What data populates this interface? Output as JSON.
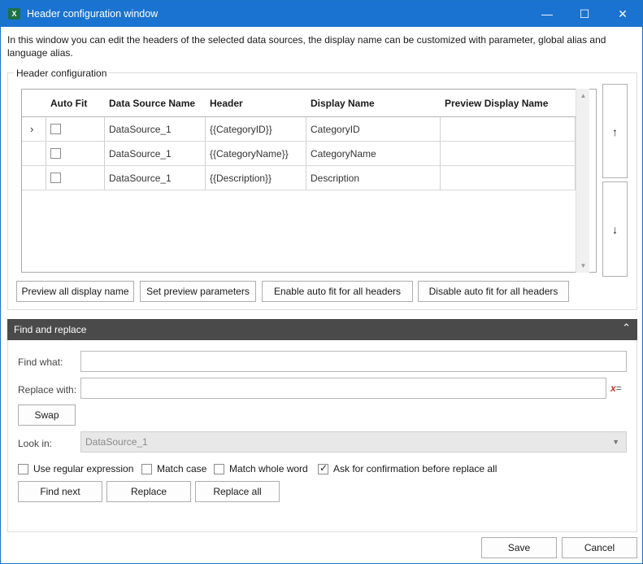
{
  "window": {
    "title": "Header configuration window",
    "app_icon": "excel-icon",
    "controls": [
      "minimize-icon",
      "maximize-icon",
      "close-icon"
    ]
  },
  "intro_text": "In this window you can edit the headers of the selected data sources, the display name can be customized with parameter, global alias and language alias.",
  "header_config": {
    "legend": "Header configuration",
    "columns": [
      "Auto Fit",
      "Data Source Name",
      "Header",
      "Display Name",
      "Preview Display Name"
    ],
    "rows": [
      {
        "auto_fit": false,
        "data_source": "DataSource_1",
        "header": "{{CategoryID}}",
        "display_name": "CategoryID",
        "preview": ""
      },
      {
        "auto_fit": false,
        "data_source": "DataSource_1",
        "header": "{{CategoryName}}",
        "display_name": "CategoryName",
        "preview": ""
      },
      {
        "auto_fit": false,
        "data_source": "DataSource_1",
        "header": "{{Description}}",
        "display_name": "Description",
        "preview": ""
      }
    ],
    "buttons": {
      "preview_all": "Preview all display name",
      "set_params": "Set preview parameters",
      "enable_auto_fit": "Enable auto fit for all headers",
      "disable_auto_fit": "Disable auto fit for all headers"
    },
    "move_up_icon": "arrow-up-icon",
    "move_down_icon": "arrow-down-icon"
  },
  "find_replace": {
    "title": "Find and replace",
    "find_label": "Find what:",
    "find_value": "",
    "replace_label": "Replace with:",
    "replace_value": "",
    "clear_glyph": "x",
    "clear_glyph_suffix": "=",
    "swap_label": "Swap",
    "look_in_label": "Look in:",
    "look_in_value": "DataSource_1",
    "options": {
      "regex": {
        "label": "Use regular expression",
        "checked": false
      },
      "match_case": {
        "label": "Match case",
        "checked": false
      },
      "whole_word": {
        "label": "Match whole word",
        "checked": false
      },
      "confirm": {
        "label": "Ask for confirmation before replace all",
        "checked": true
      }
    },
    "find_next_label": "Find next",
    "replace_label_btn": "Replace",
    "replace_all_label": "Replace all"
  },
  "footer": {
    "save_label": "Save",
    "cancel_label": "Cancel"
  },
  "colors": {
    "titlebar": "#1a73d0",
    "panel_header": "#4a4a4a"
  }
}
